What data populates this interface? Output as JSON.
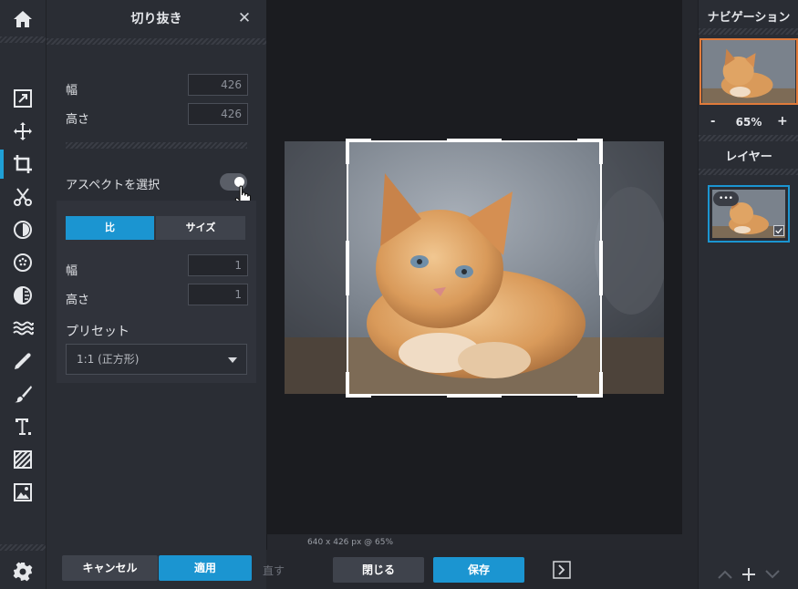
{
  "panel": {
    "title": "切り抜き",
    "close": "✕",
    "width_label": "幅",
    "width_value": "426",
    "height_label": "高さ",
    "height_value": "426",
    "aspect_label": "アスペクトを選択",
    "aspect_toggle_on": true,
    "tab_ratio": "比",
    "tab_size": "サイズ",
    "ratio_width_label": "幅",
    "ratio_width_value": "1",
    "ratio_height_label": "高さ",
    "ratio_height_value": "1",
    "preset_label": "プリセット",
    "preset_value": "1:1 (正方形)",
    "cancel": "キャンセル",
    "apply": "適用"
  },
  "canvas": {
    "status": "640 x 426 px @ 65%"
  },
  "bottom": {
    "redo_partial": "直す",
    "close": "閉じる",
    "save": "保存"
  },
  "right": {
    "navigation_title": "ナビゲーション",
    "zoom_minus": "-",
    "zoom_value": "65%",
    "zoom_plus": "+",
    "layers_title": "レイヤー",
    "layer_menu": "•••"
  },
  "colors": {
    "accent": "#1b95d1",
    "panel_bg": "#2a2d34",
    "canvas_bg": "#1b1c20",
    "nav_border": "#e07a3a"
  },
  "icons": {
    "home": "home-icon",
    "adjust": "adjust-icon",
    "move": "move-icon",
    "crop": "crop-icon",
    "cut": "scissors-icon",
    "exposure": "exposure-icon",
    "filter": "filter-icon",
    "vignette": "vignette-icon",
    "waves": "waves-icon",
    "dropper": "dropper-icon",
    "brush": "brush-icon",
    "text": "text-icon",
    "pattern": "pattern-icon",
    "image": "image-icon",
    "settings": "gear-icon"
  }
}
